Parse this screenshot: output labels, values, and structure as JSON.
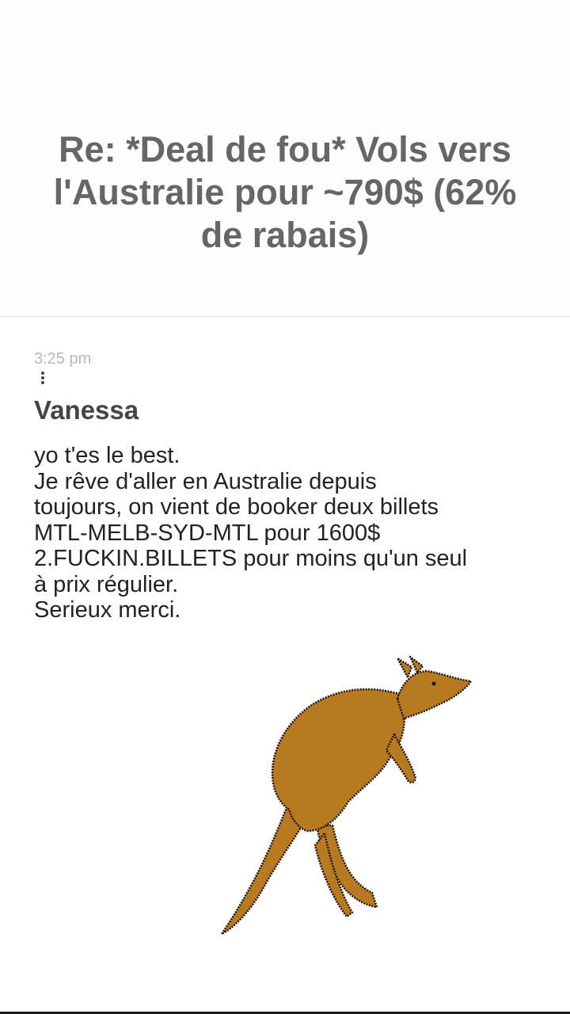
{
  "thread": {
    "title": "Re: *Deal de fou* Vols vers l'Australie pour ~790$ (62% de rabais)"
  },
  "message": {
    "time": "3:25 pm",
    "more_icon": "vertical-ellipsis-icon",
    "author": "Vanessa",
    "body_lines": [
      "yo t'es le best.",
      "Je rêve d'aller en Australie depuis",
      "toujours, on vient de booker deux billets",
      "MTL-MELB-SYD-MTL pour 1600$",
      "2.FUCKIN.BILLETS pour moins qu'un seul",
      "à prix régulier.",
      "Serieux merci."
    ],
    "gif_subject": "kangaroo"
  },
  "colors": {
    "title": "#666666",
    "timestamp": "#b9b9b9",
    "author": "#444444",
    "body": "#222222",
    "kangaroo": "#b87a20"
  }
}
